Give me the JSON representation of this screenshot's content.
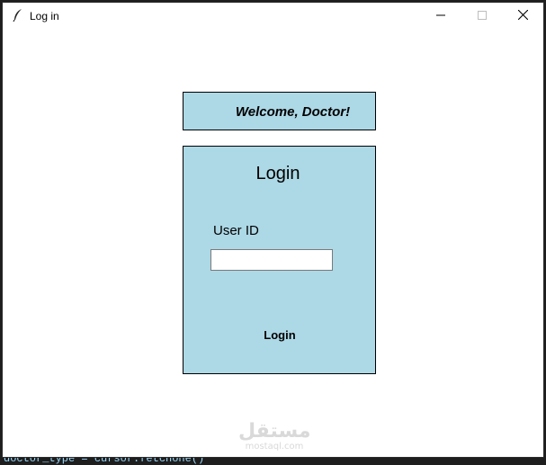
{
  "window": {
    "title": "Log in",
    "icons": {
      "app": "feather-icon",
      "minimize": "minimize-icon",
      "maximize": "maximize-icon",
      "close": "close-icon"
    }
  },
  "welcome": {
    "text": "Welcome, Doctor!"
  },
  "login": {
    "heading": "Login",
    "user_id_label": "User ID",
    "user_id_value": "",
    "button_label": "Login"
  },
  "watermark": {
    "main": "مستقل",
    "sub": "mostaql.com"
  },
  "background": {
    "code_line": "doctor_type = cursor.fetchone()"
  },
  "colors": {
    "panel_bg": "#add8e6",
    "window_bg": "#ffffff",
    "backdrop": "#1e1e1e"
  }
}
